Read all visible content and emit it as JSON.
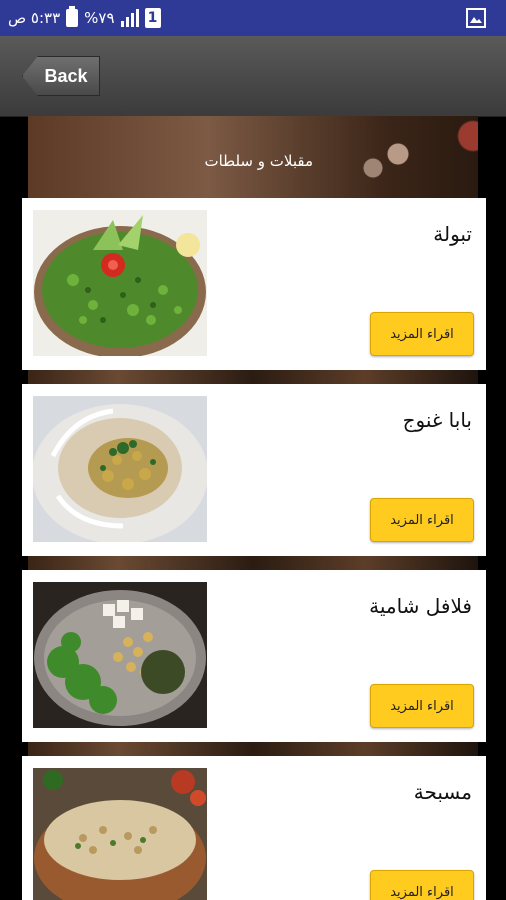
{
  "status_bar": {
    "time": "٥:٣٣ ص",
    "battery": "%٧٩",
    "sim": "1",
    "background": "#2f3a96",
    "right_icon": "gallery-icon"
  },
  "action_bar": {
    "back_label": "Back"
  },
  "header": {
    "title": "مقبلات و سلطات"
  },
  "recipes": [
    {
      "title": "تبولة",
      "button": "اقراء المزيد",
      "image": "tabbouleh-image"
    },
    {
      "title": "بابا غنوج",
      "button": "اقراء المزيد",
      "image": "baba-ghanoush-image"
    },
    {
      "title": "فلافل شامية",
      "button": "اقراء المزيد",
      "image": "falafel-ingredients-image"
    },
    {
      "title": "مسبحة",
      "button": "اقراء المزيد",
      "image": "msabbaha-image"
    }
  ],
  "colors": {
    "accent_button": "#ffcb1f",
    "card_bg": "#ffffff",
    "page_bg": "#000000"
  }
}
